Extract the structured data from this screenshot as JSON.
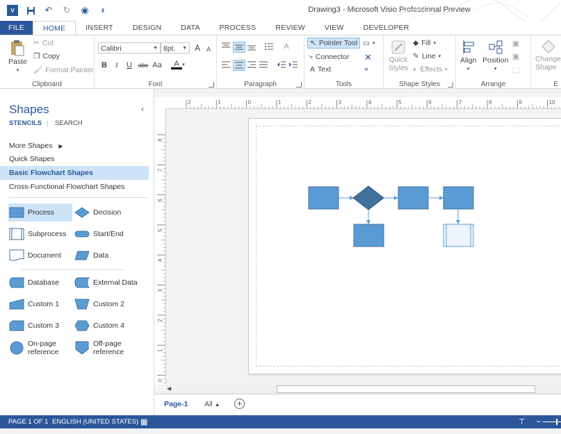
{
  "window": {
    "title": "Drawing3 - Microsoft Visio Professional Preview"
  },
  "qat": {
    "logo_text": "V"
  },
  "tabs": [
    {
      "label": "FILE"
    },
    {
      "label": "HOME"
    },
    {
      "label": "INSERT"
    },
    {
      "label": "DESIGN"
    },
    {
      "label": "DATA"
    },
    {
      "label": "PROCESS"
    },
    {
      "label": "REVIEW"
    },
    {
      "label": "VIEW"
    },
    {
      "label": "DEVELOPER"
    }
  ],
  "ribbon": {
    "clipboard": {
      "label": "Clipboard",
      "paste": "Paste",
      "cut": "Cut",
      "copy": "Copy",
      "format_painter": "Format Painter"
    },
    "font": {
      "label": "Font",
      "font_name": "Calibri",
      "font_size": "8pt.",
      "bold": "B",
      "italic": "I",
      "underline": "U",
      "strike": "abc",
      "case": "Aa",
      "color": "A",
      "grow": "A",
      "shrink": "A"
    },
    "paragraph": {
      "label": "Paragraph"
    },
    "tools": {
      "label": "Tools",
      "pointer": "Pointer Tool",
      "connector": "Connector",
      "text": "Text"
    },
    "shape_styles": {
      "label": "Shape Styles",
      "quick_styles": "Quick Styles",
      "fill": "Fill",
      "line": "Line",
      "effects": "Effects"
    },
    "arrange": {
      "label": "Arrange",
      "align": "Align",
      "position": "Position"
    },
    "change_shape": {
      "label": "Change Shape",
      "group_label": "E"
    }
  },
  "shapes_panel": {
    "title": "Shapes",
    "stencils": "STENCILS",
    "search": "SEARCH",
    "stencil_list": [
      {
        "label": "More Shapes"
      },
      {
        "label": "Quick Shapes"
      },
      {
        "label": "Basic Flowchart Shapes"
      },
      {
        "label": "Cross-Functional Flowchart Shapes"
      }
    ],
    "shapes": [
      {
        "label": "Process",
        "icon": "process-icon"
      },
      {
        "label": "Decision",
        "icon": "decision-icon"
      },
      {
        "label": "Subprocess",
        "icon": "subprocess-icon"
      },
      {
        "label": "Start/End",
        "icon": "start-end-icon"
      },
      {
        "label": "Document",
        "icon": "document-icon"
      },
      {
        "label": "Data",
        "icon": "data-icon"
      },
      {
        "label": "Database",
        "icon": "database-icon"
      },
      {
        "label": "External Data",
        "icon": "external-data-icon"
      },
      {
        "label": "Custom 1",
        "icon": "custom1-icon"
      },
      {
        "label": "Custom 2",
        "icon": "custom2-icon"
      },
      {
        "label": "Custom 3",
        "icon": "custom3-icon"
      },
      {
        "label": "Custom 4",
        "icon": "custom4-icon"
      },
      {
        "label": "On-page reference",
        "line1": "On-page",
        "line2": "reference",
        "icon": "on-page-reference-icon"
      },
      {
        "label": "Off-page reference",
        "line1": "Off-page",
        "line2": "reference",
        "icon": "off-page-reference-icon"
      }
    ]
  },
  "rulers": {
    "h_ticks": [
      "2",
      "1",
      "0",
      "1",
      "2",
      "3",
      "4",
      "5",
      "6",
      "7",
      "8",
      "9",
      "10"
    ],
    "v_ticks": [
      "8",
      "7",
      "6",
      "5",
      "4",
      "3",
      "2",
      "1",
      "0"
    ]
  },
  "page_tabs": {
    "current": "Page-1",
    "all": "All"
  },
  "status": {
    "page": "PAGE 1 OF 1",
    "language": "ENGLISH (UNITED STATES)"
  },
  "colors": {
    "accent": "#2b579a",
    "shape_fill": "#5b9bd5",
    "shape_stroke": "#41719c",
    "selected": "#cde3f7"
  }
}
